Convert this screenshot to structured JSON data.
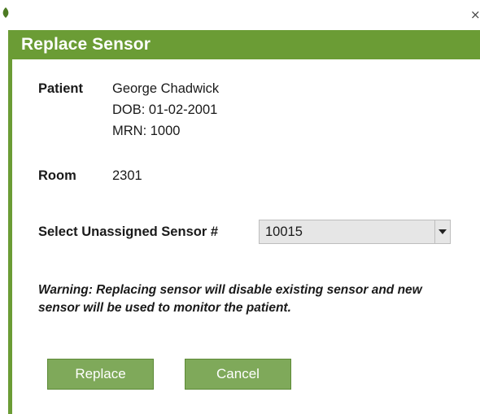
{
  "window": {
    "close_glyph": "×",
    "app_icon": "leaf-icon"
  },
  "dialog": {
    "title": "Replace Sensor"
  },
  "patient": {
    "label": "Patient",
    "name": "George Chadwick",
    "dob": "DOB: 01-02-2001",
    "mrn": "MRN: 1000"
  },
  "room": {
    "label": "Room",
    "value": "2301"
  },
  "sensor": {
    "label": "Select Unassigned Sensor #",
    "selected": "10015",
    "arrow_icon": "chevron-down-icon"
  },
  "warning": "Warning: Replacing sensor will disable existing sensor and new sensor will be used to monitor the patient.",
  "buttons": {
    "replace": "Replace",
    "cancel": "Cancel"
  },
  "colors": {
    "accent": "#6b9c35",
    "button": "#7fa95a",
    "select_bg": "#e6e6e6"
  }
}
